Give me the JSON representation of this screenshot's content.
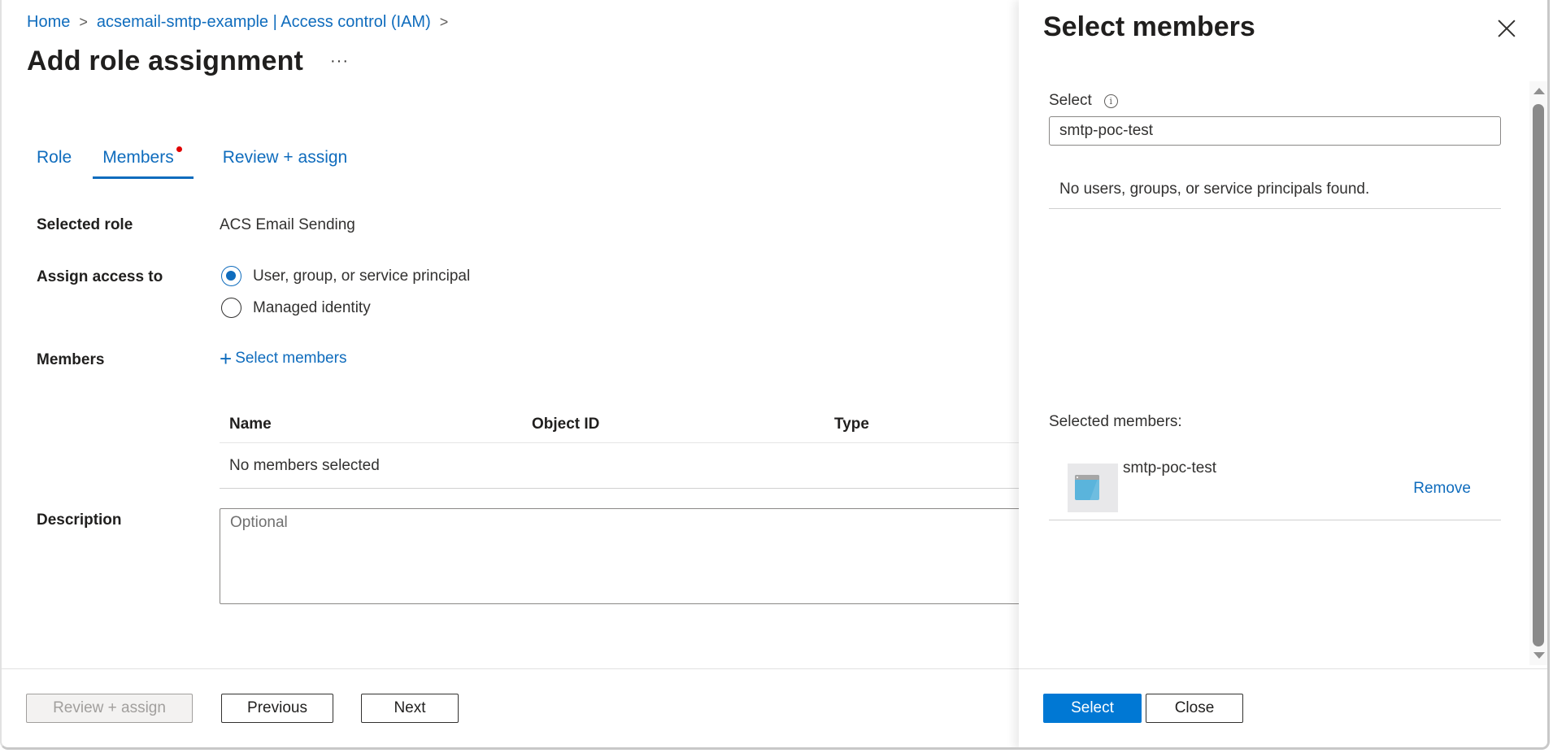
{
  "breadcrumb": {
    "items": [
      {
        "label": "Home"
      },
      {
        "label": "acsemail-smtp-example | Access control (IAM)"
      }
    ],
    "separator": ">"
  },
  "page": {
    "title": "Add role assignment",
    "more_label": "···"
  },
  "tabs": [
    {
      "label": "Role",
      "active": false
    },
    {
      "label": "Members",
      "active": true,
      "has_indicator": true
    },
    {
      "label": "Review + assign",
      "active": false
    }
  ],
  "form": {
    "selected_role": {
      "label": "Selected role",
      "value": "ACS Email Sending"
    },
    "assign_access": {
      "label": "Assign access to",
      "options": [
        {
          "label": "User, group, or service principal",
          "checked": true
        },
        {
          "label": "Managed identity",
          "checked": false
        }
      ]
    },
    "members": {
      "label": "Members",
      "select_link": "Select members",
      "table": {
        "columns": [
          "Name",
          "Object ID",
          "Type"
        ],
        "empty_text": "No members selected"
      }
    },
    "description": {
      "label": "Description",
      "placeholder": "Optional",
      "value": ""
    }
  },
  "footer": {
    "review_assign": "Review + assign",
    "previous": "Previous",
    "next": "Next"
  },
  "panel": {
    "title": "Select members",
    "select_label": "Select",
    "search_value": "smtp-poc-test",
    "no_results": "No users, groups, or service principals found.",
    "selected_label": "Selected members:",
    "selected_members": [
      {
        "name": "smtp-poc-test",
        "icon": "app-registration-icon",
        "remove_label": "Remove"
      }
    ],
    "select_button": "Select",
    "close_button": "Close"
  },
  "colors": {
    "accent": "#0f6cbd",
    "primary_button": "#0078d4",
    "indicator_dot": "#e00000"
  }
}
